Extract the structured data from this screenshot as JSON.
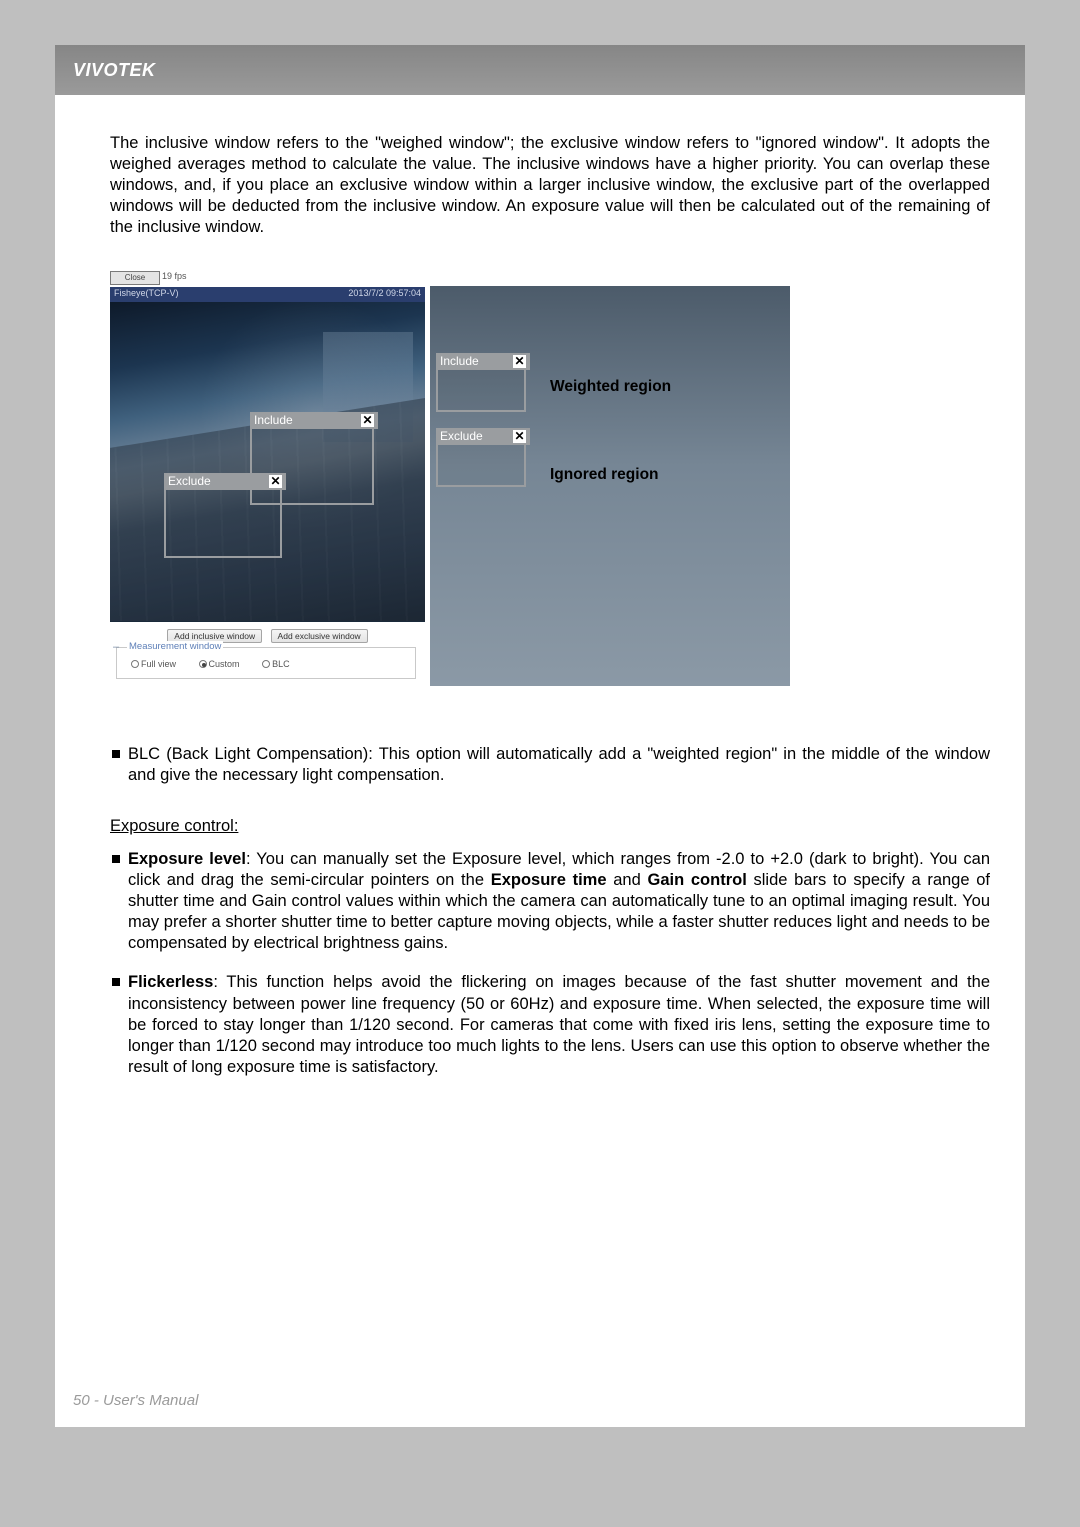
{
  "brand": "VIVOTEK",
  "intro": "The inclusive window refers to the \"weighed window\"; the exclusive window refers to \"ignored window\". It adopts the weighed averages method to calculate the value. The inclusive windows have a higher priority. You can overlap these windows, and, if you place an exclusive window within a larger inclusive window, the exclusive part of the overlapped windows will be deducted from the inclusive window. An exposure value will then be calculated out of the remaining of the inclusive window.",
  "camera_ui": {
    "close_btn": "Close",
    "fps": "19 fps",
    "titlebar_left": "Fisheye(TCP-V)",
    "titlebar_right": "2013/7/2 09:57:04",
    "overlay_include": "Include",
    "overlay_exclude": "Exclude",
    "btn_add_inclusive": "Add inclusive window",
    "btn_add_exclusive": "Add exclusive window",
    "measurement_window": {
      "title": "Measurement window",
      "opt_full": "Full view",
      "opt_custom": "Custom",
      "opt_blc": "BLC",
      "selected": "Custom"
    }
  },
  "legend": {
    "include": "Include",
    "exclude": "Exclude",
    "weighted": "Weighted region",
    "ignored": "Ignored region"
  },
  "blc_text": "BLC (Back Light Compensation): This option will automatically add a \"weighted region\" in the middle of the window and give the necessary light compensation.",
  "exposure_heading": "Exposure control:",
  "exp_level_lead": "Exposure level",
  "exp_level_text": ": You can manually set the Exposure level, which ranges from -2.0 to +2.0 (dark to bright). You can click and drag the semi-circular pointers on the ",
  "exp_level_bold2": "Exposure time",
  "exp_level_text2": " and ",
  "exp_level_bold3": "Gain control",
  "exp_level_text3": " slide bars to specify a range of shutter time and Gain control values within which the camera can automatically tune to an optimal imaging result. You may prefer a shorter shutter time to better capture moving objects, while a faster shutter reduces light and needs to be compensated by electrical brightness gains.",
  "flicker_lead": "Flickerless",
  "flicker_text": ": This function helps avoid the flickering on images because of the fast shutter movement and the inconsistency between power line frequency (50 or 60Hz) and exposure time. When selected, the exposure time will be forced to stay longer than 1/120 second. For cameras that come with fixed iris lens, setting the exposure time to longer than 1/120 second may introduce too much lights to the lens. Users can use this option to observe whether the result of long exposure time is satisfactory.",
  "footer": "50 - User's Manual"
}
